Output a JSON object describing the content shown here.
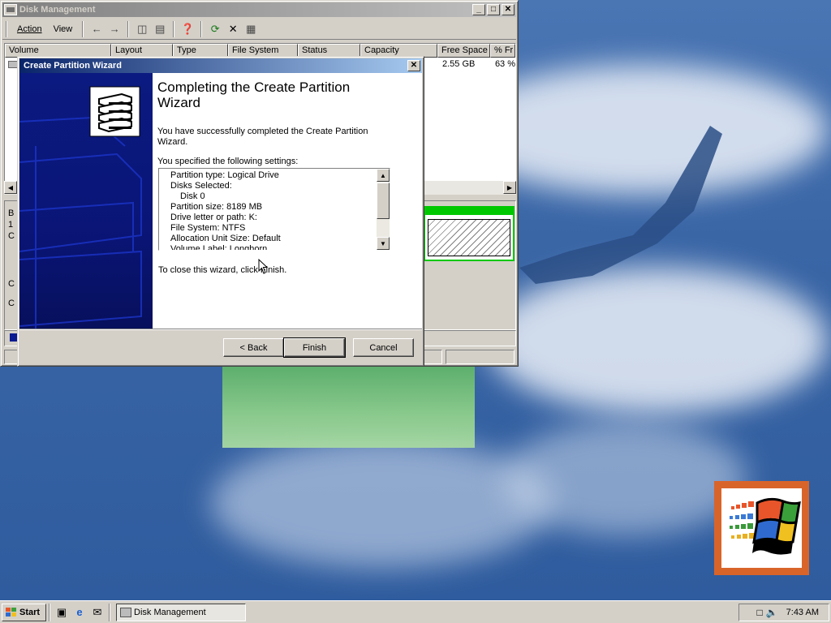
{
  "disk_management": {
    "title": "Disk Management",
    "menu": [
      "Action",
      "View"
    ],
    "columns": [
      "Volume",
      "Layout",
      "Type",
      "File System",
      "Status",
      "Capacity",
      "Free Space",
      "% Fr"
    ],
    "row": {
      "free_space": "2.55 GB",
      "pct_free": "63 %"
    },
    "graph_labels": [
      "B",
      "1",
      "C",
      "C",
      "C"
    ]
  },
  "wizard": {
    "title": "Create Partition Wizard",
    "heading": "Completing the Create Partition Wizard",
    "success_text": "You have successfully completed the Create Partition Wizard.",
    "settings_intro": "You specified the following settings:",
    "settings": [
      "Partition type: Logical Drive",
      "Disks Selected:",
      "Disk 0",
      "Partition size: 8189 MB",
      "Drive letter or path: K:",
      "File System: NTFS",
      "Allocation Unit Size: Default",
      "Volume Label: Longhorn"
    ],
    "close_text": "To close this wizard, click Finish.",
    "buttons": {
      "back": "< Back",
      "finish": "Finish",
      "cancel": "Cancel"
    }
  },
  "taskbar": {
    "start_label": "Start",
    "task_label": "Disk Management",
    "clock": "7:43 AM"
  },
  "icons": [
    "disk-management-icon",
    "back-arrow-icon",
    "forward-arrow-icon",
    "folder-up-icon",
    "properties-icon",
    "help-icon",
    "refresh-icon",
    "delete-icon",
    "settings-icon",
    "drive-stack-icon",
    "windows-flag-icon",
    "show-desktop-icon",
    "internet-explorer-icon",
    "outlook-icon",
    "network-tray-icon",
    "volume-tray-icon"
  ],
  "colors": {
    "title_active": "#0a246a",
    "title_inactive": "#808080",
    "wizard_side": "#0b1a80",
    "partition_green": "#00c800"
  }
}
